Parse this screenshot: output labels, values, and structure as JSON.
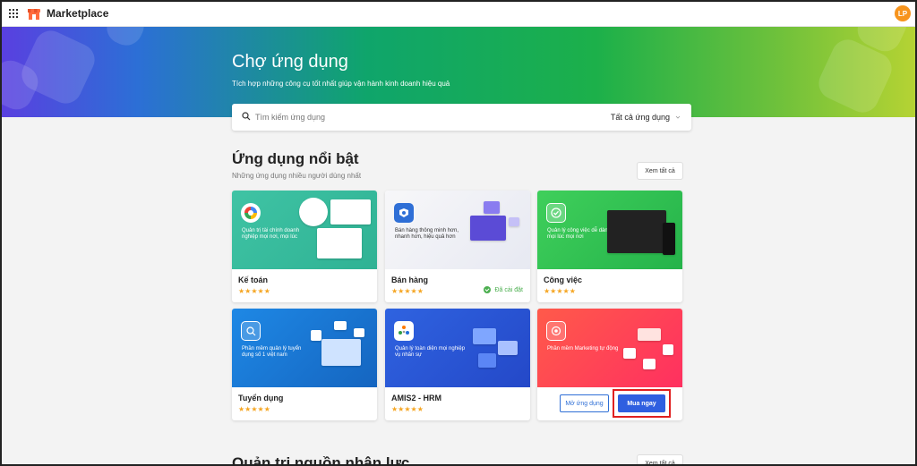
{
  "topbar": {
    "app_title": "Marketplace",
    "avatar_initials": "LP"
  },
  "hero": {
    "title": "Chợ ứng dụng",
    "subtitle": "Tích hợp những công cụ tốt nhất giúp vận hành kinh doanh hiệu quả"
  },
  "search": {
    "placeholder": "Tìm kiếm ứng dụng",
    "category": "Tất cả ứng dụng"
  },
  "featured": {
    "title": "Ứng dụng nổi bật",
    "subtitle": "Những ứng dụng nhiều người dùng nhất",
    "view_all": "Xem tất cả",
    "apps": [
      {
        "name": "Kế toán",
        "banner_text": "Quản trị tài chính doanh nghiệp mọi nơi, mọi lúc",
        "stars": "★★★★★"
      },
      {
        "name": "Bán hàng",
        "banner_text": "Bán hàng thông minh hơn, nhanh hơn, hiệu quả hơn",
        "stars": "★★★★★",
        "status": "Đã cài đặt"
      },
      {
        "name": "Công việc",
        "banner_text": "Quản lý công việc dễ dàng, mọi lúc mọi nơi",
        "stars": "★★★★★"
      },
      {
        "name": "Tuyển dụng",
        "banner_text": "Phần mềm quản lý tuyển dụng số 1 việt nam",
        "stars": "★★★★★"
      },
      {
        "name": "AMIS2 - HRM",
        "banner_text": "Quản lý toàn diện mọi nghiệp vụ nhân sự",
        "stars": "★★★★★"
      },
      {
        "banner_text": "Phần mềm Marketing tự động",
        "open_label": "Mở ứng dụng",
        "buy_label": "Mua ngay"
      }
    ]
  },
  "hr_section": {
    "title": "Quản trị nguồn nhân lực",
    "view_all": "Xem tất cả"
  },
  "colors": {
    "accent": "#2f5fe0",
    "star": "#f5a623",
    "installed": "#4caf50",
    "highlight": "#e02020"
  }
}
